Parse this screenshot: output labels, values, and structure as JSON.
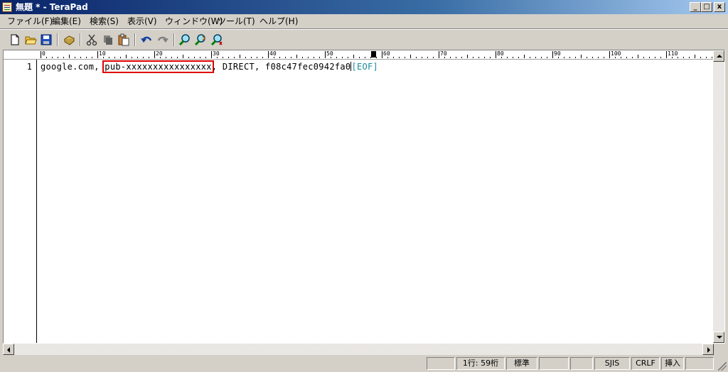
{
  "window": {
    "title": "無題 * - TeraPad",
    "minimize": "_",
    "maximize": "□",
    "close": "x"
  },
  "menu": [
    {
      "label": "ファイル(F)"
    },
    {
      "label": "編集(E)"
    },
    {
      "label": "検索(S)"
    },
    {
      "label": "表示(V)"
    },
    {
      "label": "ウィンドウ(W)"
    },
    {
      "label": "ツール(T)"
    },
    {
      "label": "ヘルプ(H)"
    }
  ],
  "toolbar": {
    "icons": [
      "new-file-icon",
      "open-folder-icon",
      "save-icon",
      "print-icon",
      "cut-icon",
      "copy-icon",
      "paste-icon",
      "undo-icon",
      "redo-icon",
      "find-icon",
      "find-next-icon",
      "replace-icon"
    ]
  },
  "ruler": {
    "labels": [
      "0",
      "10",
      "20",
      "30",
      "40",
      "50",
      "60",
      "70",
      "80",
      "90",
      "100",
      "110"
    ]
  },
  "editor": {
    "line_number": "1",
    "text_before": "google.com, ",
    "highlighted_text": "pub-xxxxxxxxxxxxxxxx",
    "text_after": ", DIRECT, f08c47fec0942fa0",
    "eof_marker": "[EOF]",
    "highlight_color": "#e00000",
    "eof_color": "#1a8c9c"
  },
  "status": {
    "position": "1行:  59桁",
    "mode": "標準",
    "encoding": "SJIS",
    "line_ending": "CRLF",
    "insert_mode": "挿入"
  }
}
